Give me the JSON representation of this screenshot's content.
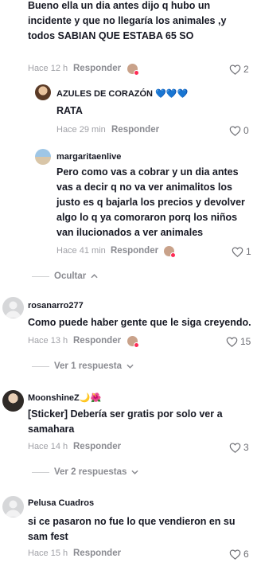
{
  "comments": [
    {
      "text": "Bueno ella un dia antes dijo q hubo un incidente y que no llegaría los animales ,y todos SABIAN QUE ESTABA 65 SO",
      "time": "Hace 12 h",
      "reply_label": "Responder",
      "likes": "2"
    },
    {
      "username": "AZULES DE CORAZÓN 💙💙💙",
      "text": "RATA",
      "time": "Hace 29 min",
      "reply_label": "Responder",
      "likes": "0"
    },
    {
      "username": "margaritaenlive",
      "text": "Pero como vas a cobrar y un dia antes vas a decir q no va ver animalitos los justo es q bajarla los precios y devolver algo lo q ya comoraron porq los niños van ilucionados a ver animales",
      "time": "Hace 41 min",
      "reply_label": "Responder",
      "likes": "1"
    },
    {
      "username": "rosanarro277",
      "text": "Como puede haber gente que le siga creyendo.",
      "time": "Hace 13 h",
      "reply_label": "Responder",
      "likes": "15"
    },
    {
      "username": "MoonshineZ🌙🌺",
      "text": "[Sticker] Debería ser gratis por solo ver a samahara",
      "time": "Hace 14 h",
      "reply_label": "Responder",
      "likes": "3"
    },
    {
      "username": "Pelusa Cuadros",
      "text": "si ce pasaron no fue lo que vendieron en su sam fest",
      "time": "Hace 15 h",
      "reply_label": "Responder",
      "likes": "6"
    }
  ],
  "threads": {
    "hide_label": "Ocultar",
    "view_1": "Ver 1 respuesta",
    "view_2": "Ver 2 respuestas"
  },
  "colors": {
    "like_count": "#6d6e74",
    "meta": "#a0a1a7",
    "accent_dot": "#fe2c55"
  }
}
